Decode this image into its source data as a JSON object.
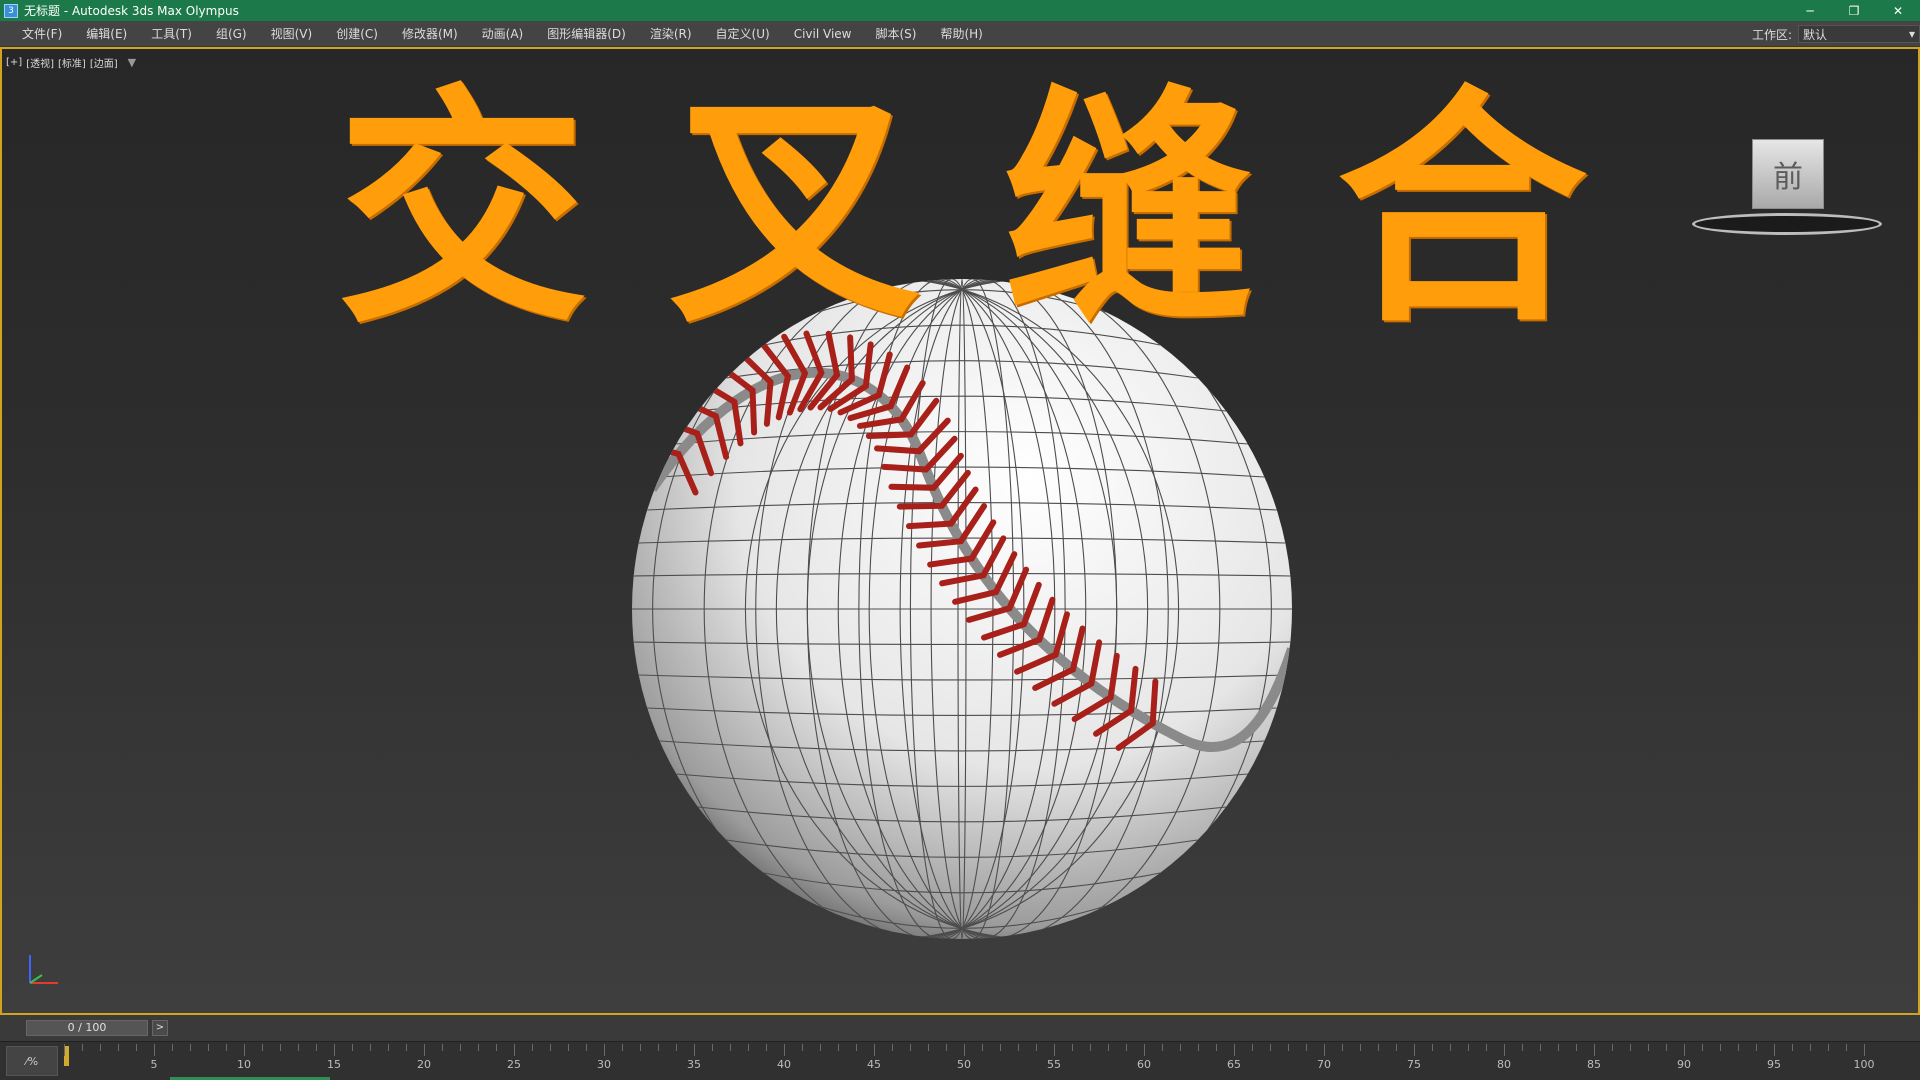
{
  "window": {
    "title": "无标题 - Autodesk 3ds Max Olympus",
    "app_icon_glyph": "3",
    "controls": [
      "─",
      "❐",
      "✕"
    ]
  },
  "menubar": {
    "items": [
      "文件(F)",
      "编辑(E)",
      "工具(T)",
      "组(G)",
      "视图(V)",
      "创建(C)",
      "修改器(M)",
      "动画(A)",
      "图形编辑器(D)",
      "渲染(R)",
      "自定义(U)",
      "Civil View",
      "脚本(S)",
      "帮助(H)"
    ],
    "workspace_label": "工作区:",
    "workspace_value": "默认"
  },
  "viewport": {
    "labels": [
      "[+]",
      "[透视]",
      "[标准]",
      "[边面]"
    ],
    "filter_icon": "filter-icon",
    "overlay_title_chars": [
      "交",
      "叉",
      "缝",
      "合"
    ],
    "overlay_color": "#ff9d0a",
    "viewcube_face": "前",
    "border_color": "#d2a31e",
    "model_name": "baseball"
  },
  "timeline": {
    "frame_display": "0 / 100",
    "next_label": ">",
    "current_frame": 0,
    "start": 0,
    "end": 100,
    "tick_labels": [
      "5",
      "10",
      "15",
      "20",
      "25",
      "30",
      "35",
      "40",
      "45",
      "50",
      "55",
      "60",
      "65",
      "70",
      "75",
      "80",
      "85",
      "90",
      "95",
      "100"
    ],
    "corner_label": "⁄%"
  }
}
